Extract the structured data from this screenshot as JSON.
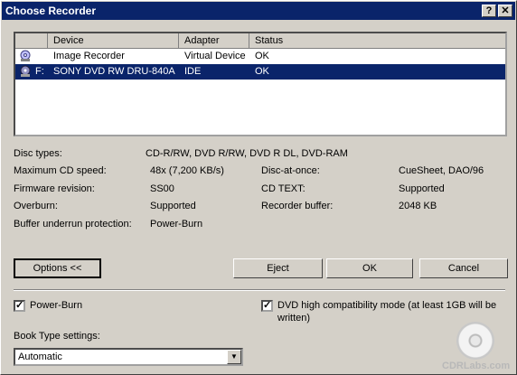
{
  "window": {
    "title": "Choose Recorder",
    "help_glyph": "?",
    "close_glyph": "✕"
  },
  "devices": {
    "headers": [
      "Device",
      "Adapter",
      "Status"
    ],
    "rows": [
      {
        "letter": "",
        "device": "Image Recorder",
        "adapter": "Virtual Device",
        "status": "OK",
        "selected": false
      },
      {
        "letter": "F:",
        "device": "SONY DVD RW DRU-840A",
        "adapter": "IDE",
        "status": "OK",
        "selected": true
      }
    ]
  },
  "info": {
    "disc_types_label": "Disc types:",
    "disc_types_value": "CD-R/RW, DVD R/RW, DVD R DL, DVD-RAM",
    "max_speed_label": "Maximum CD speed:",
    "max_speed_value": "48x (7,200 KB/s)",
    "dao_label": "Disc-at-once:",
    "dao_value": "CueSheet, DAO/96",
    "firmware_label": "Firmware revision:",
    "firmware_value": "SS00",
    "cdtext_label": "CD TEXT:",
    "cdtext_value": "Supported",
    "overburn_label": "Overburn:",
    "overburn_value": "Supported",
    "buffer_label": "Recorder buffer:",
    "buffer_value": "2048 KB",
    "underrun_label": "Buffer underrun protection:",
    "underrun_value": "Power-Burn"
  },
  "buttons": {
    "options": "Options <<",
    "eject": "Eject",
    "ok": "OK",
    "cancel": "Cancel"
  },
  "options": {
    "powerburn_label": "Power-Burn",
    "powerburn_checked": true,
    "dvd_compat_label_1": "DVD high compatibility mode (at least 1GB will be",
    "dvd_compat_label_2": "written)",
    "dvd_compat_checked": true,
    "book_type_label": "Book Type settings:",
    "book_type_value": "Automatic",
    "check_glyph": "✓",
    "dropdown_glyph": "▼"
  },
  "watermark": "CDRLabs.com"
}
